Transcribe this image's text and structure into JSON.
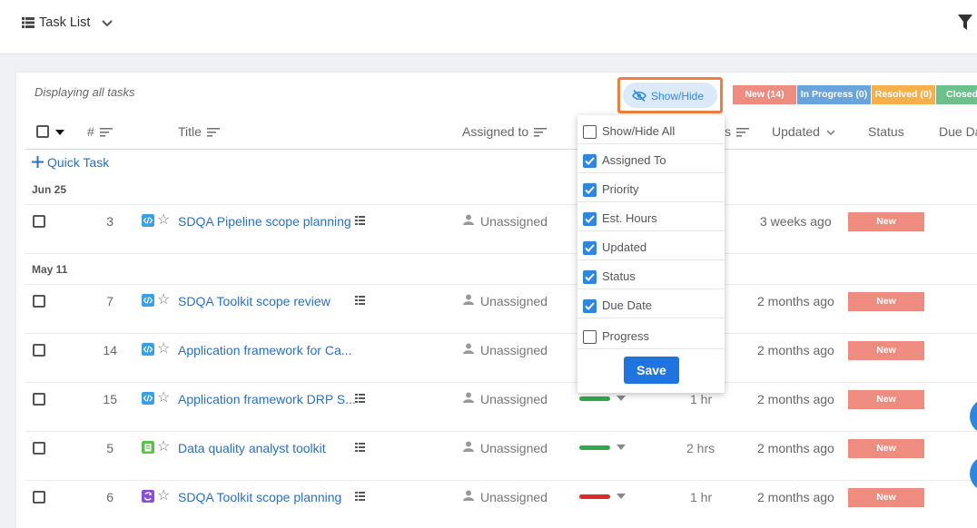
{
  "topbar": {
    "title": "Task List"
  },
  "panel": {
    "displaying": "Displaying all tasks"
  },
  "show_hide": {
    "label": "Show/Hide"
  },
  "badges": [
    {
      "label": "New (14)",
      "color": "#ef8c80"
    },
    {
      "label": "In Progress (0)",
      "color": "#6aa4dc"
    },
    {
      "label": "Resolved (0)",
      "color": "#f5b04a"
    },
    {
      "label": "Closed",
      "color": "#6cc18b"
    }
  ],
  "columns": {
    "number": "#",
    "title": "Title",
    "assigned": "Assigned to",
    "hours_partial": "s",
    "updated": "Updated",
    "status": "Status",
    "due": "Due Da"
  },
  "quick_task": "Quick Task",
  "groups": [
    "Jun 25",
    "May 11"
  ],
  "tasks": [
    {
      "number": "3",
      "title": "SDQA Pipeline scope planning",
      "assigned": "Unassigned",
      "priority_color": "",
      "hours": "",
      "updated": "3 weeks ago",
      "status": "New",
      "icon": "code-icon"
    },
    {
      "number": "7",
      "title": "SDQA Toolkit scope review",
      "assigned": "Unassigned",
      "priority_color": "",
      "hours": "",
      "updated": "2 months ago",
      "status": "New",
      "icon": "code-icon"
    },
    {
      "number": "14",
      "title": "Application framework for Ca...",
      "assigned": "Unassigned",
      "priority_color": "",
      "hours": "",
      "updated": "2 months ago",
      "status": "New",
      "icon": "code-icon"
    },
    {
      "number": "15",
      "title": "Application framework DRP S...",
      "assigned": "Unassigned",
      "priority_color": "#2faa4a",
      "hours": "1 hr",
      "updated": "2 months ago",
      "status": "New",
      "icon": "code-icon"
    },
    {
      "number": "5",
      "title": "Data quality analyst toolkit",
      "assigned": "Unassigned",
      "priority_color": "#2faa4a",
      "hours": "2 hrs",
      "updated": "2 months ago",
      "status": "New",
      "icon": "clipboard-icon"
    },
    {
      "number": "6",
      "title": "SDQA Toolkit scope planning",
      "assigned": "Unassigned",
      "priority_color": "#e02a2a",
      "hours": "1 hr",
      "updated": "2 months ago",
      "status": "New",
      "icon": "cycle-icon"
    }
  ],
  "dropdown": {
    "items": [
      {
        "label": "Show/Hide All",
        "checked": false
      },
      {
        "label": "Assigned To",
        "checked": true
      },
      {
        "label": "Priority",
        "checked": true
      },
      {
        "label": "Est. Hours",
        "checked": true
      },
      {
        "label": "Updated",
        "checked": true
      },
      {
        "label": "Status",
        "checked": true
      },
      {
        "label": "Due Date",
        "checked": true
      },
      {
        "label": "Progress",
        "checked": false
      }
    ],
    "save": "Save"
  }
}
